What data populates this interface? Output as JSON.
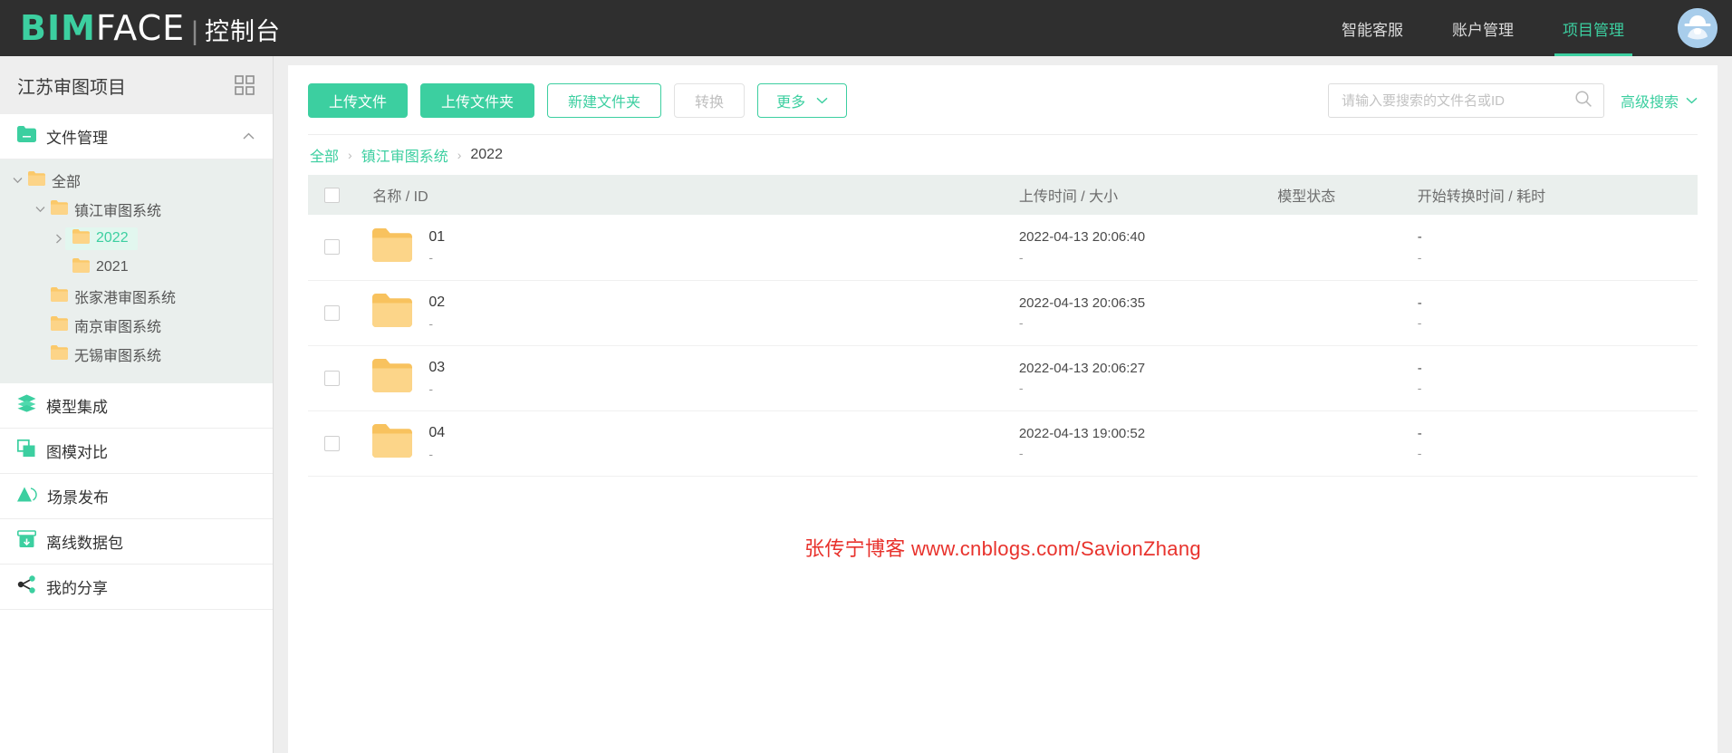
{
  "header": {
    "logo_bim": "BIM",
    "logo_face": "FACE",
    "logo_separator": "|",
    "logo_console": "控制台",
    "nav": [
      {
        "label": "智能客服",
        "active": false
      },
      {
        "label": "账户管理",
        "active": false
      },
      {
        "label": "项目管理",
        "active": true
      }
    ],
    "avatar_icon": "user-avatar-icon",
    "accent_color": "#3ccfa0",
    "background_color": "#2f2f2f"
  },
  "sidebar": {
    "project_title": "江苏审图项目",
    "grid_icon": "grid-view-icon",
    "file_manage": {
      "label": "文件管理",
      "icon": "folder-green-icon",
      "collapse_icon": "chevron-up-icon",
      "expanded": true
    },
    "tree": [
      {
        "label": "全部",
        "depth": 0,
        "arrow": "chevron-down-icon",
        "expanded": true,
        "selected": false
      },
      {
        "label": "镇江审图系统",
        "depth": 1,
        "arrow": "chevron-down-icon",
        "expanded": true,
        "selected": false
      },
      {
        "label": "2022",
        "depth": 2,
        "arrow": "chevron-right-icon",
        "expanded": false,
        "selected": true
      },
      {
        "label": "2021",
        "depth": 2,
        "arrow": "",
        "expanded": false,
        "selected": false
      },
      {
        "label": "张家港审图系统",
        "depth": 1,
        "arrow": "",
        "expanded": false,
        "selected": false
      },
      {
        "label": "南京审图系统",
        "depth": 1,
        "arrow": "",
        "expanded": false,
        "selected": false
      },
      {
        "label": "无锡审图系统",
        "depth": 1,
        "arrow": "",
        "expanded": false,
        "selected": false
      }
    ],
    "items": [
      {
        "label": "模型集成",
        "icon": "layers-icon"
      },
      {
        "label": "图模对比",
        "icon": "compare-squares-icon"
      },
      {
        "label": "场景发布",
        "icon": "mountain-publish-icon"
      },
      {
        "label": "离线数据包",
        "icon": "download-box-icon"
      },
      {
        "label": "我的分享",
        "icon": "share-nodes-icon"
      }
    ]
  },
  "toolbar": {
    "upload_file": "上传文件",
    "upload_folder": "上传文件夹",
    "new_folder": "新建文件夹",
    "convert": "转换",
    "more": "更多",
    "more_chevron": "chevron-down-icon",
    "search_placeholder": "请输入要搜索的文件名或ID",
    "search_value": "",
    "search_icon": "search-icon",
    "advanced_search": "高级搜索",
    "advanced_chevron": "chevron-down-icon"
  },
  "breadcrumb": {
    "items": [
      {
        "label": "全部",
        "link": true
      },
      {
        "label": "镇江审图系统",
        "link": true
      },
      {
        "label": "2022",
        "link": false
      }
    ],
    "separator": "›"
  },
  "table": {
    "select_all_checkbox": false,
    "columns": [
      {
        "key": "name",
        "label": "名称 / ID"
      },
      {
        "key": "time",
        "label": "上传时间 / 大小"
      },
      {
        "key": "status",
        "label": "模型状态"
      },
      {
        "key": "convert",
        "label": "开始转换时间 / 耗时"
      }
    ],
    "rows": [
      {
        "checked": false,
        "icon": "folder-yellow-icon",
        "name": "01",
        "id": "-",
        "upload_time": "2022-04-13 20:06:40",
        "size": "-",
        "status": "",
        "convert_start": "-",
        "convert_duration": "-"
      },
      {
        "checked": false,
        "icon": "folder-yellow-icon",
        "name": "02",
        "id": "-",
        "upload_time": "2022-04-13 20:06:35",
        "size": "-",
        "status": "",
        "convert_start": "-",
        "convert_duration": "-"
      },
      {
        "checked": false,
        "icon": "folder-yellow-icon",
        "name": "03",
        "id": "-",
        "upload_time": "2022-04-13 20:06:27",
        "size": "-",
        "status": "",
        "convert_start": "-",
        "convert_duration": "-"
      },
      {
        "checked": false,
        "icon": "folder-yellow-icon",
        "name": "04",
        "id": "-",
        "upload_time": "2022-04-13 19:00:52",
        "size": "-",
        "status": "",
        "convert_start": "-",
        "convert_duration": "-"
      }
    ]
  },
  "watermark": {
    "text": "张传宁博客 www.cnblogs.com/SavionZhang",
    "color": "#e8322c"
  }
}
